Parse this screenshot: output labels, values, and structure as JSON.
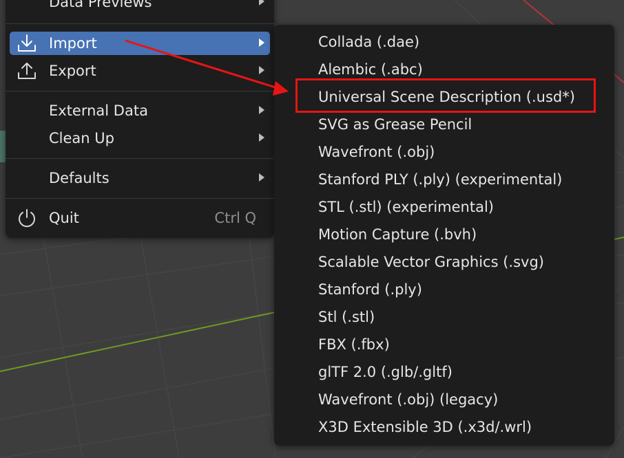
{
  "file_menu": {
    "items": [
      {
        "label": "Data Previews",
        "has_submenu": true
      },
      {
        "label": "Import",
        "has_submenu": true,
        "active": true,
        "icon": "import-icon"
      },
      {
        "label": "Export",
        "has_submenu": true,
        "icon": "export-icon"
      },
      {
        "label": "External Data",
        "has_submenu": true
      },
      {
        "label": "Clean Up",
        "has_submenu": true
      },
      {
        "label": "Defaults",
        "has_submenu": true
      },
      {
        "label": "Quit",
        "shortcut": "Ctrl Q",
        "icon": "power-icon"
      }
    ]
  },
  "import_submenu": {
    "items": [
      "Collada (.dae)",
      "Alembic (.abc)",
      "Universal Scene Description (.usd*)",
      "SVG as Grease Pencil",
      "Wavefront (.obj)",
      "Stanford PLY (.ply) (experimental)",
      "STL (.stl) (experimental)",
      "Motion Capture (.bvh)",
      "Scalable Vector Graphics (.svg)",
      "Stanford (.ply)",
      "Stl (.stl)",
      "FBX (.fbx)",
      "glTF 2.0 (.glb/.gltf)",
      "Wavefront (.obj) (legacy)",
      "X3D Extensible 3D (.x3d/.wrl)"
    ],
    "highlighted_item": "Universal Scene Description (.usd*)"
  },
  "colors": {
    "menu_bg": "#1d1d1d",
    "active_item": "#4772b3",
    "annotation": "#e81414",
    "viewport_bg": "#3d3d3d",
    "axis_red": "#b5323c",
    "axis_green": "#6d9a25"
  }
}
